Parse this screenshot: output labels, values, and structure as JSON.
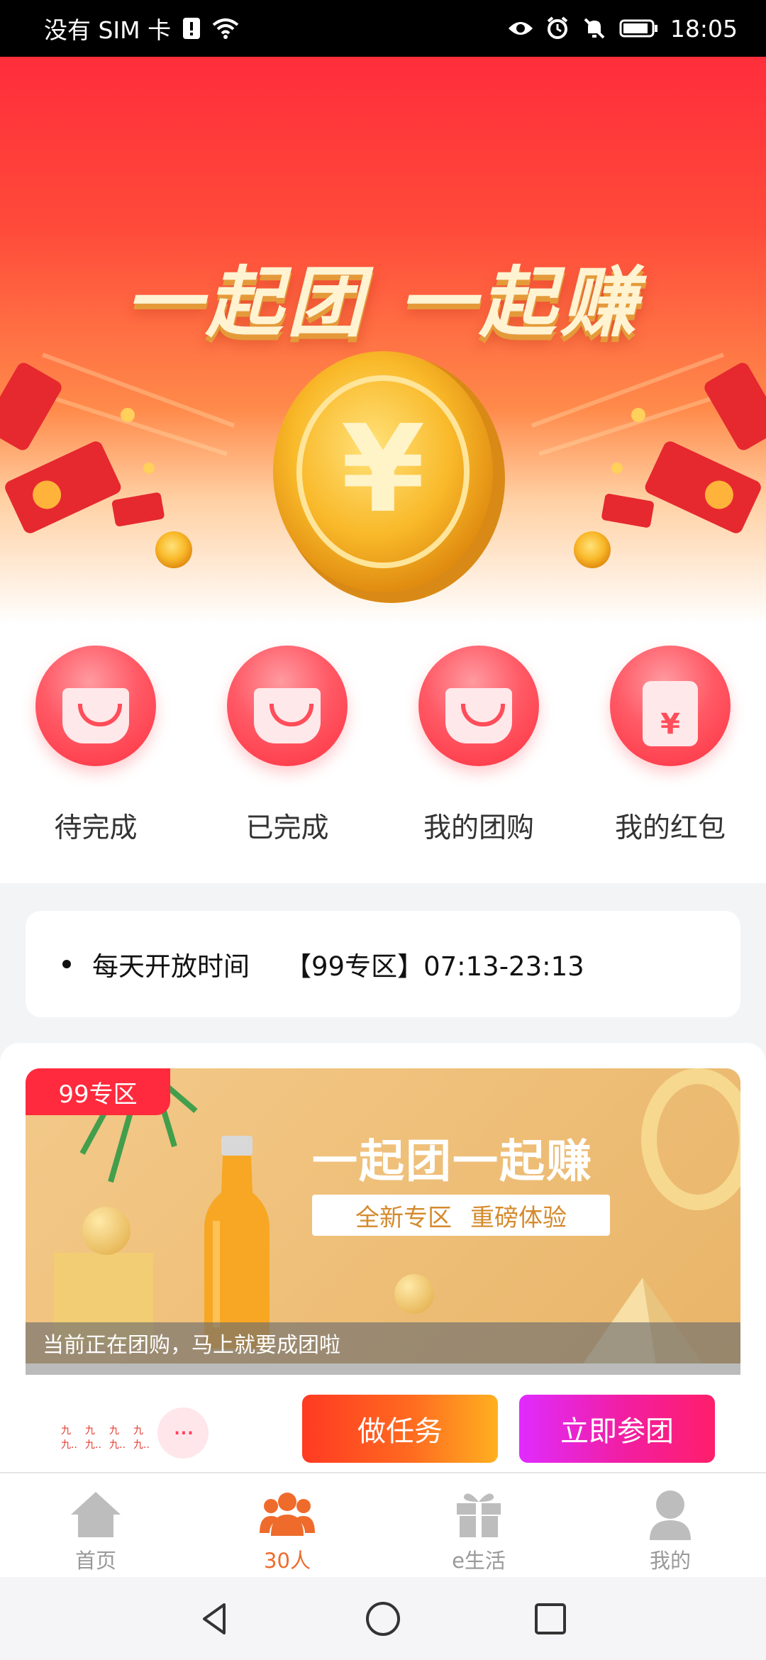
{
  "status_bar": {
    "carrier": "没有 SIM 卡",
    "time": "18:05",
    "icons": [
      "sim-alert-icon",
      "wifi-icon",
      "eye-icon",
      "alarm-icon",
      "mute-icon",
      "battery-icon"
    ]
  },
  "hero": {
    "title": "一起团 一起赚",
    "colors": {
      "top": "#ff2d3b",
      "bottom": "#ffd0a3",
      "title": "#fff3d2"
    }
  },
  "categories": [
    {
      "label": "待完成",
      "icon": "pending-bag-icon"
    },
    {
      "label": "已完成",
      "icon": "completed-bag-icon"
    },
    {
      "label": "我的团购",
      "icon": "group-buy-bag-icon"
    },
    {
      "label": "我的红包",
      "icon": "red-envelope-icon"
    }
  ],
  "notice": {
    "label": "每天开放时间",
    "zone": "【99专区】07:13-23:13"
  },
  "card": {
    "badge": "99专区",
    "banner_title": "一起团一起赚",
    "banner_sub_1": "全新专区",
    "banner_sub_2": "重磅体验",
    "banner_footer": "当前正在团购，马上就要成团啦",
    "avatars": [
      "九九..",
      "九九..",
      "九九..",
      "九九.."
    ],
    "more": "···",
    "btn_task": "做任务",
    "btn_join": "立即参团"
  },
  "tabs": [
    {
      "label": "首页",
      "icon": "home-icon",
      "active": false
    },
    {
      "label": "30人",
      "icon": "group-icon",
      "active": true
    },
    {
      "label": "e生活",
      "icon": "gift-icon",
      "active": false
    },
    {
      "label": "我的",
      "icon": "profile-icon",
      "active": false
    }
  ],
  "accent": "#ef6b2b"
}
